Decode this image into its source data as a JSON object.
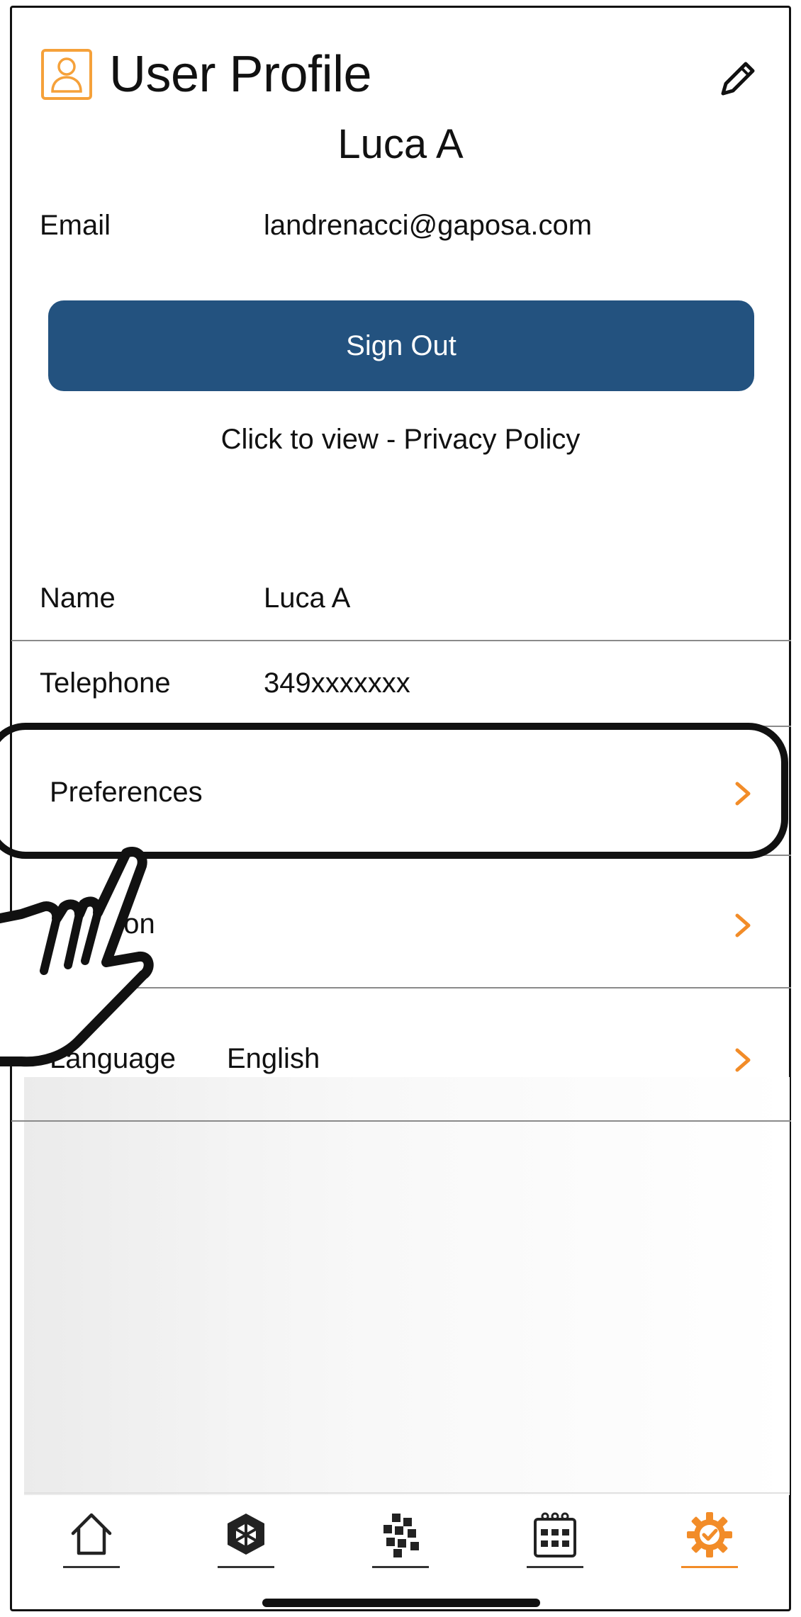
{
  "header": {
    "title": "User Profile",
    "icon": "user-icon",
    "edit_icon": "pencil-icon"
  },
  "profile": {
    "name": "Luca A",
    "email_label": "Email",
    "email_value": "landrenacci@gaposa.com"
  },
  "actions": {
    "sign_out_label": "Sign Out",
    "privacy_link": "Click to view - Privacy Policy"
  },
  "details": [
    {
      "label": "Name",
      "value": "Luca A"
    },
    {
      "label": "Telephone",
      "value": "349xxxxxxx"
    }
  ],
  "menu": [
    {
      "label": "Preferences",
      "value": "",
      "icon": "chevron-right-icon"
    },
    {
      "label": "ation",
      "value": "",
      "icon": "chevron-right-icon"
    },
    {
      "label": "Language",
      "value": "English",
      "icon": "chevron-right-icon"
    }
  ],
  "tabbar": {
    "items": [
      {
        "icon": "home-icon"
      },
      {
        "icon": "cube-icon"
      },
      {
        "icon": "grid-icon"
      },
      {
        "icon": "calendar-icon"
      },
      {
        "icon": "settings-gear-icon",
        "active": true
      }
    ]
  },
  "colors": {
    "accent": "#f28c28",
    "primary_button": "#23527f",
    "text": "#111111"
  }
}
